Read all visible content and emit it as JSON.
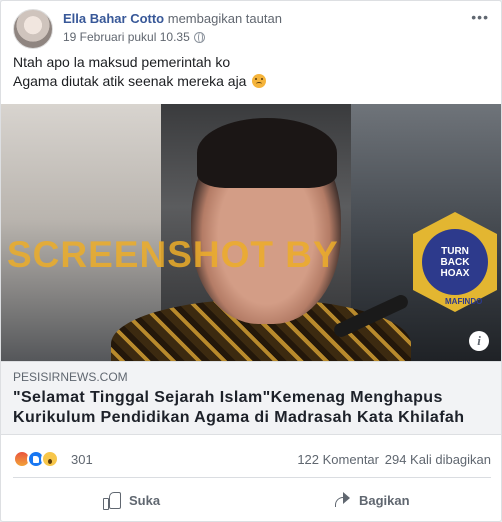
{
  "post": {
    "author_name": "Ella Bahar Cotto",
    "action_text": "membagikan tautan",
    "timestamp": "19 Februari pukul 10.35",
    "privacy_icon": "globe-icon",
    "more_label": "•••",
    "text_line1": "Ntah apo la maksud pemerintah ko",
    "text_line2": "Agama diutak atik seenak mereka aja",
    "text_emoji": "frowning-face-emoji"
  },
  "link": {
    "watermark": "SCREENSHOT BY",
    "badge_line1": "TURN",
    "badge_line2": "BACK",
    "badge_line3": "HOAX",
    "badge_org": "MAFINDO",
    "info_label": "i",
    "domain": "PESISIRNEWS.COM",
    "title": "\"Selamat Tinggal Sejarah Islam\"Kemenag Menghapus Kurikulum Pendidikan Agama di Madrasah Kata Khilafah da…"
  },
  "stats": {
    "reactions_count": "301",
    "reaction_icons": [
      "angry-reaction-icon",
      "like-reaction-icon",
      "wow-reaction-icon"
    ],
    "comments": "122 Komentar",
    "shares": "294 Kali dibagikan"
  },
  "actions": {
    "like_label": "Suka",
    "share_label": "Bagikan"
  },
  "colors": {
    "link_blue": "#385898",
    "meta_gray": "#616770",
    "watermark_orange": "#ecad28",
    "badge_navy": "#2d3a8c"
  }
}
